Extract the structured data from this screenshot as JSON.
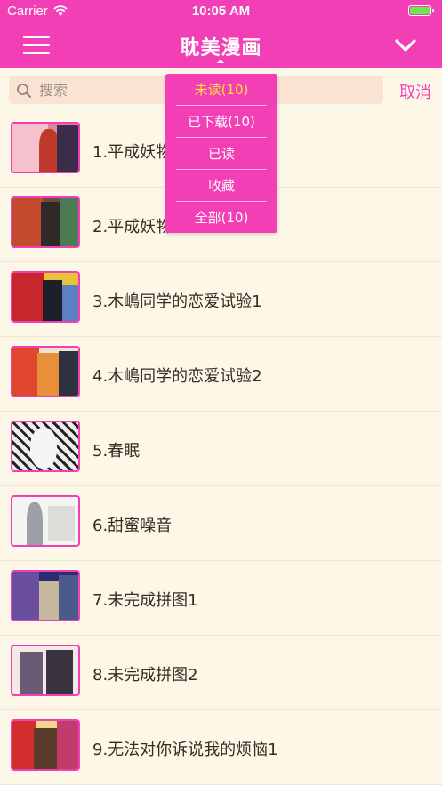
{
  "status_bar": {
    "carrier": "Carrier",
    "time": "10:05 AM"
  },
  "nav": {
    "title": "耽美漫画"
  },
  "search": {
    "placeholder": "搜索",
    "value": "",
    "cancel_label": "取消"
  },
  "dropdown": {
    "items": [
      {
        "label": "未读(10)",
        "selected": true
      },
      {
        "label": "已下载(10)",
        "selected": false
      },
      {
        "label": "已读",
        "selected": false
      },
      {
        "label": "收藏",
        "selected": false
      },
      {
        "label": "全部(10)",
        "selected": false
      }
    ]
  },
  "list": {
    "items": [
      {
        "title": "1.平成妖物"
      },
      {
        "title": "2.平成妖物"
      },
      {
        "title": "3.木嶋同学的恋爱试验1"
      },
      {
        "title": "4.木嶋同学的恋爱试验2"
      },
      {
        "title": "5.春眠"
      },
      {
        "title": "6.甜蜜噪音"
      },
      {
        "title": "7.未完成拼图1"
      },
      {
        "title": "8.未完成拼图2"
      },
      {
        "title": "9.无法对你诉说我的烦恼1"
      }
    ]
  },
  "colors": {
    "accent": "#f23fb5",
    "background": "#fdf7e7",
    "search_bg": "#fbe3d4",
    "selected_dropdown_text": "#ffe13a"
  },
  "icons": {
    "menu": "hamburger-icon",
    "dropdown": "chevron-down-icon",
    "search": "search-icon",
    "wifi": "wifi-icon",
    "battery": "battery-icon"
  }
}
